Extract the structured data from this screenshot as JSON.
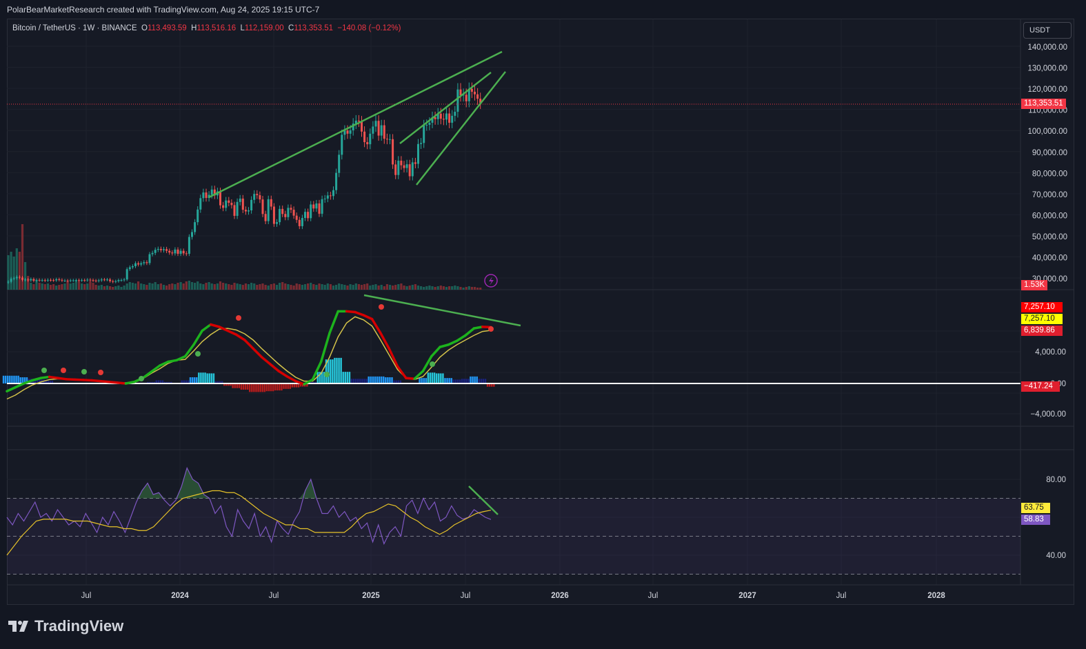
{
  "header": {
    "caption": "PolarBearMarketResearch created with TradingView.com, Aug 24, 2025 19:15 UTC-7",
    "symbol": "Bitcoin / TetherUS · 1W · BINANCE",
    "o_label": "O",
    "o_value": "113,493.59",
    "h_label": "H",
    "h_value": "113,516.16",
    "l_label": "L",
    "l_value": "112,159.00",
    "c_label": "C",
    "c_value": "113,353.51",
    "change": "−140.08 (−0.12%)"
  },
  "currency_button": "USDT",
  "footer_brand": "TradingView",
  "colors": {
    "up": "#26a69a",
    "down": "#ef5350",
    "trend": "#4caf50",
    "background": "#161a25"
  },
  "chart_data": {
    "type": "candlestick",
    "symbol": "BTC/USDT",
    "interval": "1W",
    "x_axis": {
      "ticks": [
        "Jul",
        "2024",
        "Jul",
        "2025",
        "Jul",
        "2026",
        "Jul",
        "2027",
        "Jul",
        "2028"
      ]
    },
    "price_pane": {
      "y_ticks": [
        "140,000.00",
        "130,000.00",
        "120,000.00",
        "110,000.00",
        "100,000.00",
        "90,000.00",
        "80,000.00",
        "70,000.00",
        "60,000.00",
        "50,000.00",
        "40,000.00",
        "30,000.00"
      ],
      "ylim": [
        25000,
        145000
      ],
      "last_price_label": "113,353.51",
      "volume_label": "1.53K",
      "closes": [
        28500,
        30000,
        30200,
        30800,
        30500,
        29400,
        29600,
        29200,
        29800,
        29000,
        29400,
        29200,
        29300,
        29100,
        29400,
        29300,
        29200,
        29700,
        29400,
        29100,
        29100,
        29000,
        29200,
        29200,
        29300,
        29200,
        29300,
        29200,
        29500,
        29300,
        29100,
        28900,
        29200,
        29600,
        29500,
        29600,
        28800,
        28500,
        28800,
        29300,
        29300,
        29600,
        34500,
        35400,
        35900,
        37300,
        36700,
        37300,
        37800,
        37400,
        41600,
        42200,
        43700,
        44100,
        43500,
        44000,
        43200,
        42400,
        42000,
        43800,
        41800,
        43200,
        42000,
        41800,
        49800,
        52100,
        56800,
        62800,
        68200,
        70900,
        68300,
        69800,
        72300,
        69500,
        71400,
        64800,
        63600,
        67100,
        66000,
        64900,
        59800,
        66400,
        68000,
        62700,
        61900,
        62400,
        67400,
        70200,
        69600,
        67600,
        60700,
        57300,
        67700,
        64200,
        56000,
        56800,
        63100,
        60700,
        59200,
        63600,
        62700,
        59900,
        57900,
        54900,
        58800,
        61700,
        58700,
        65200,
        63300,
        65700,
        60800,
        67700,
        68000,
        69500,
        69200,
        72000,
        80200,
        88800,
        98300,
        100300,
        98800,
        100400,
        103600,
        105000,
        104600,
        99800,
        94800,
        93800,
        98800,
        102200,
        104900,
        97900,
        102800,
        96400,
        96200,
        96200,
        84200,
        79200,
        86000,
        83800,
        82500,
        84300,
        78600,
        85200,
        84500,
        93900,
        94400,
        102800,
        103000,
        104000,
        106600,
        105700,
        108300,
        105900,
        105500,
        108400,
        104000,
        107300,
        109200,
        119800,
        117000,
        117300,
        114200,
        120100,
        118700,
        117500,
        115400,
        113353
      ],
      "trendlines": [
        {
          "from": [
            "2024-03",
            68000
          ],
          "to": [
            "2025-08",
            138000
          ]
        },
        {
          "from": [
            "2025-02",
            94000
          ],
          "to": [
            "2025-08",
            128000
          ]
        },
        {
          "from": [
            "2025-04",
            74000
          ],
          "to": [
            "2025-09",
            128000
          ]
        }
      ]
    },
    "oscillator_pane": {
      "y_ticks": [
        "4,000.00",
        "0.00",
        "−4,000.00"
      ],
      "labels": [
        "7,257.10",
        "7,257.10",
        "6,839.86",
        "−417.24"
      ],
      "series": [
        {
          "name": "fast",
          "values": [
            -1000,
            -500,
            0,
            400,
            700,
            850,
            700,
            550,
            500,
            450,
            400,
            300,
            200,
            100,
            0,
            200,
            700,
            1500,
            2300,
            2800,
            3000,
            3500,
            5000,
            6800,
            7600,
            7300,
            6800,
            6300,
            5600,
            4500,
            3400,
            2500,
            1600,
            900,
            300,
            -100,
            500,
            2800,
            6500,
            9300,
            9300,
            9200,
            8800,
            8300,
            6500,
            4500,
            2200,
            700,
            600,
            1600,
            3500,
            4700,
            5000,
            5500,
            6200,
            7100,
            7300,
            7257
          ]
        },
        {
          "name": "signal",
          "values": [
            -2000,
            -1500,
            -800,
            -200,
            200,
            500,
            600,
            550,
            500,
            450,
            400,
            300,
            200,
            100,
            100,
            100,
            600,
            1300,
            1900,
            2600,
            3000,
            3100,
            4200,
            5400,
            6300,
            7000,
            7100,
            6900,
            6400,
            5600,
            4500,
            3500,
            2500,
            1600,
            800,
            300,
            300,
            1300,
            3400,
            6000,
            7800,
            8600,
            8200,
            7400,
            5600,
            3700,
            1800,
            700,
            500,
            900,
            2100,
            3400,
            4300,
            5000,
            5600,
            6200,
            6700,
            6840
          ]
        }
      ],
      "histogram": [
        1000,
        1000,
        800,
        600,
        500,
        350,
        100,
        0,
        0,
        0,
        0,
        0,
        0,
        0,
        -100,
        100,
        100,
        200,
        400,
        200,
        0,
        400,
        800,
        1400,
        1300,
        300,
        -300,
        -600,
        -800,
        -1100,
        -1100,
        -1000,
        -900,
        -700,
        -500,
        -400,
        200,
        1500,
        3100,
        3300,
        1500,
        600,
        600,
        900,
        900,
        800,
        400,
        0,
        100,
        700,
        1400,
        1300,
        700,
        500,
        600,
        900,
        600,
        -417
      ]
    },
    "rsi_pane": {
      "y_ticks": [
        "80.00",
        "40.00"
      ],
      "labels": [
        "63.75",
        "58.83"
      ],
      "bands": [
        70,
        50,
        30
      ],
      "rsi": [
        60,
        56,
        62,
        58,
        63,
        68,
        60,
        62,
        58,
        64,
        60,
        56,
        58,
        55,
        62,
        57,
        52,
        60,
        56,
        63,
        58,
        52,
        60,
        68,
        74,
        78,
        72,
        73,
        69,
        66,
        69,
        76,
        86,
        80,
        78,
        72,
        70,
        62,
        66,
        55,
        50,
        64,
        58,
        54,
        62,
        50,
        55,
        47,
        58,
        54,
        51,
        58,
        63,
        74,
        80,
        70,
        62,
        62,
        66,
        60,
        63,
        58,
        60,
        54,
        57,
        47,
        56,
        46,
        52,
        55,
        50,
        66,
        69,
        62,
        70,
        64,
        68,
        58,
        60,
        66,
        61,
        59,
        60,
        64,
        62,
        60,
        58.83
      ],
      "rsi_ma": [
        40,
        45,
        50,
        54,
        58,
        59,
        59,
        59,
        59,
        58,
        58,
        58,
        57,
        56,
        55,
        55,
        54,
        54,
        53,
        53,
        55,
        59,
        63,
        67,
        70,
        71,
        72,
        73,
        74,
        74,
        73,
        73,
        71,
        68,
        65,
        62,
        60,
        58,
        56,
        56,
        54,
        54,
        52,
        52,
        52,
        52,
        52,
        55,
        59,
        62,
        63,
        65,
        67,
        66,
        63,
        60,
        58,
        55,
        53,
        51,
        53,
        56,
        58,
        60,
        62,
        63,
        63.75
      ]
    }
  }
}
